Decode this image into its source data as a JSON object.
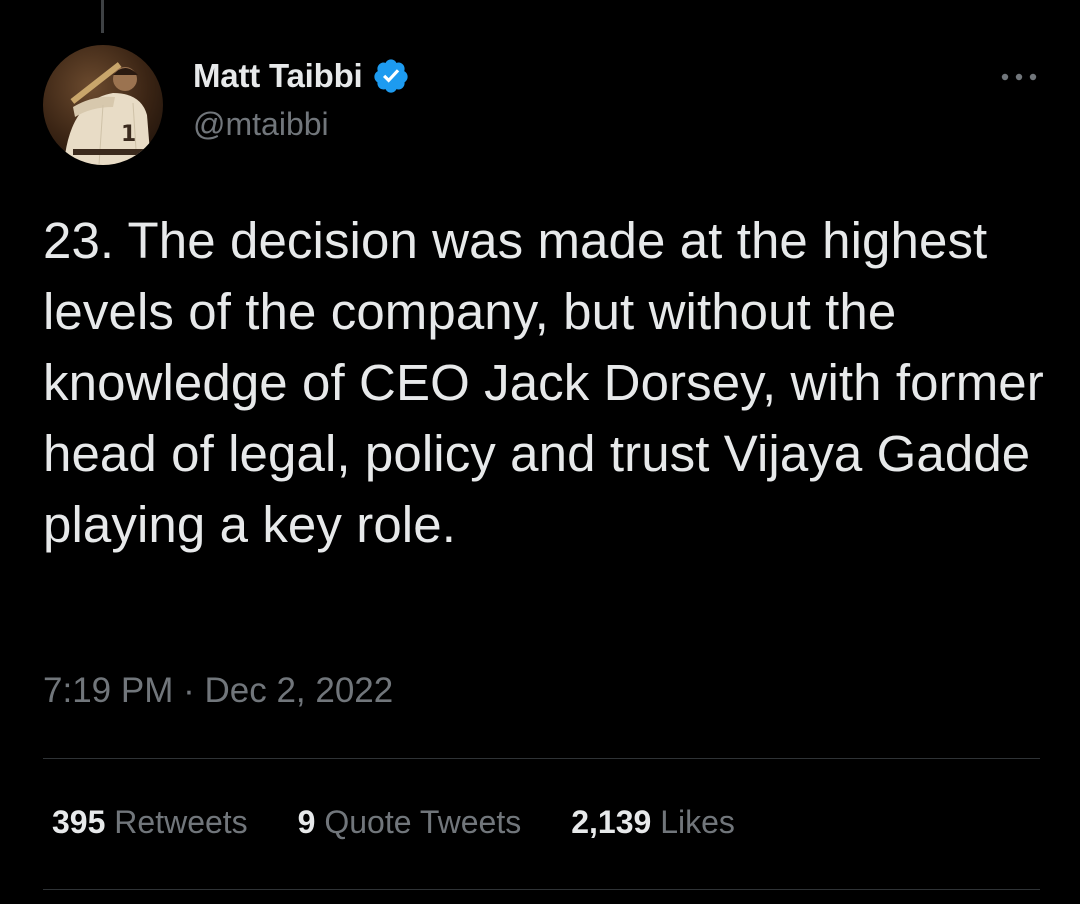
{
  "author": {
    "display_name": "Matt Taibbi",
    "handle": "@mtaibbi",
    "verified": true,
    "verified_color": "#1d9bf0",
    "avatar_icon": "baseball-player-photo"
  },
  "tweet": {
    "text": "23. The decision was made at the highest levels of the company, but without the knowledge of CEO Jack Dorsey, with former head of legal, policy and trust Vijaya Gadde playing a key role.",
    "time": "7:19 PM",
    "separator": "·",
    "date": "Dec 2, 2022"
  },
  "stats": {
    "retweets_count": "395",
    "retweets_label": "Retweets",
    "quotes_count": "9",
    "quotes_label": "Quote Tweets",
    "likes_count": "2,139",
    "likes_label": "Likes"
  },
  "icons": {
    "more": "more-horizontal-icon"
  },
  "colors": {
    "background": "#000000",
    "text_primary": "#e7e9ea",
    "text_secondary": "#71767b",
    "divider": "#2f3336"
  }
}
